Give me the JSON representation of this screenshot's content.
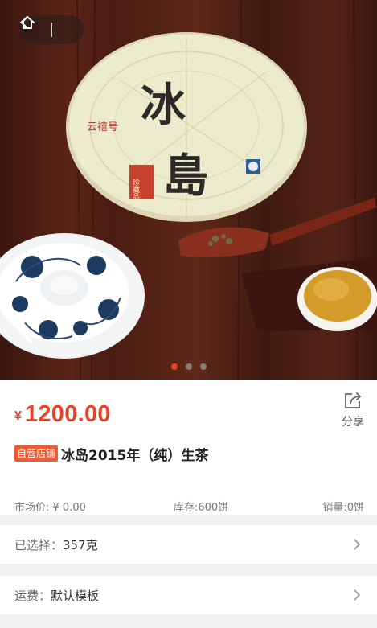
{
  "product": {
    "price_symbol": "¥",
    "price": "1200.00",
    "badge": "自营店铺",
    "title": "冰岛2015年（纯）生茶",
    "market_price": "市场价: ¥ 0.00",
    "stock": "库存:600饼",
    "sales": "销量:0饼"
  },
  "share": {
    "label": "分享"
  },
  "carousel": {
    "total": 3,
    "active": 1
  },
  "tea_cake": {
    "main_char_1": "冰",
    "main_char_2": "島",
    "brand": "云禧号",
    "seal": "珍藏品"
  },
  "options": {
    "selected_label": "已选择：",
    "selected_value": "357克",
    "shipping_label": "运费：",
    "shipping_value": "默认模板"
  },
  "icons": {
    "back": "chevron-left-icon",
    "home": "home-icon",
    "share": "share-icon",
    "chevron": "chevron-right-icon"
  },
  "colors": {
    "accent": "#e8432a",
    "badge": "#ed5b34",
    "dot_active": "#f0411e"
  }
}
